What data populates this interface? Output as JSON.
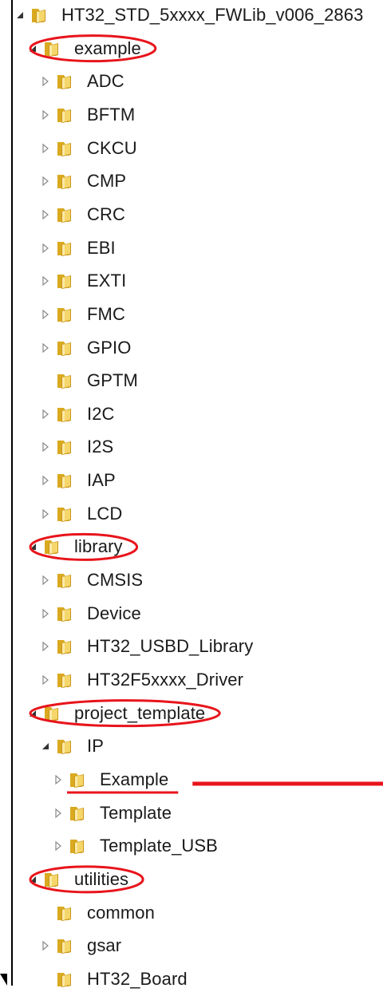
{
  "colors": {
    "annotation": "#e8141b",
    "folder_light": "#f5d66b",
    "folder_dark": "#d9a920",
    "text": "#1a1a1a"
  },
  "tree": [
    {
      "label": "HT32_STD_5xxxx_FWLib_v006_2863",
      "level": 0,
      "toggle": "expanded"
    },
    {
      "label": "example",
      "level": 1,
      "toggle": "expanded",
      "circled": true
    },
    {
      "label": "ADC",
      "level": 2,
      "toggle": "collapsed"
    },
    {
      "label": "BFTM",
      "level": 2,
      "toggle": "collapsed"
    },
    {
      "label": "CKCU",
      "level": 2,
      "toggle": "collapsed"
    },
    {
      "label": "CMP",
      "level": 2,
      "toggle": "collapsed"
    },
    {
      "label": "CRC",
      "level": 2,
      "toggle": "collapsed"
    },
    {
      "label": "EBI",
      "level": 2,
      "toggle": "collapsed"
    },
    {
      "label": "EXTI",
      "level": 2,
      "toggle": "collapsed"
    },
    {
      "label": "FMC",
      "level": 2,
      "toggle": "collapsed"
    },
    {
      "label": "GPIO",
      "level": 2,
      "toggle": "collapsed"
    },
    {
      "label": "GPTM",
      "level": 2,
      "toggle": "none"
    },
    {
      "label": "I2C",
      "level": 2,
      "toggle": "collapsed"
    },
    {
      "label": "I2S",
      "level": 2,
      "toggle": "collapsed"
    },
    {
      "label": "IAP",
      "level": 2,
      "toggle": "collapsed"
    },
    {
      "label": "LCD",
      "level": 2,
      "toggle": "collapsed"
    },
    {
      "label": "library",
      "level": 1,
      "toggle": "expanded",
      "circled": true
    },
    {
      "label": "CMSIS",
      "level": 2,
      "toggle": "collapsed"
    },
    {
      "label": "Device",
      "level": 2,
      "toggle": "collapsed"
    },
    {
      "label": "HT32_USBD_Library",
      "level": 2,
      "toggle": "collapsed"
    },
    {
      "label": "HT32F5xxxx_Driver",
      "level": 2,
      "toggle": "collapsed"
    },
    {
      "label": "project_template",
      "level": 1,
      "toggle": "expanded",
      "circled": true
    },
    {
      "label": "IP",
      "level": 2,
      "toggle": "expanded"
    },
    {
      "label": "Example",
      "level": 3,
      "toggle": "collapsed",
      "underlined": true,
      "arrow": true
    },
    {
      "label": "Template",
      "level": 3,
      "toggle": "collapsed"
    },
    {
      "label": "Template_USB",
      "level": 3,
      "toggle": "collapsed"
    },
    {
      "label": "utilities",
      "level": 1,
      "toggle": "expanded",
      "circled": true
    },
    {
      "label": "common",
      "level": 2,
      "toggle": "none"
    },
    {
      "label": "gsar",
      "level": 2,
      "toggle": "collapsed"
    },
    {
      "label": "HT32_Board",
      "level": 2,
      "toggle": "none"
    }
  ]
}
